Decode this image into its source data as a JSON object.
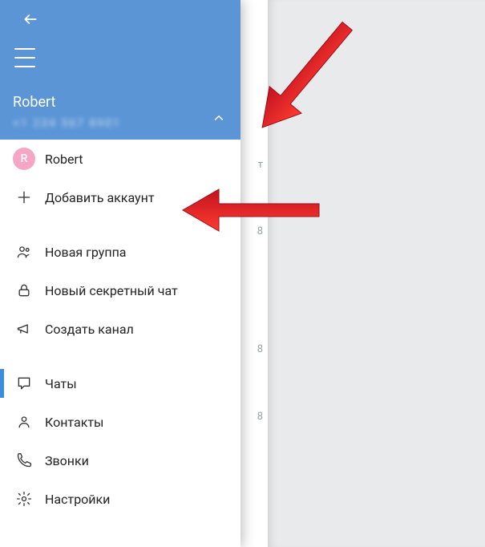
{
  "header": {
    "account_name": "Robert",
    "account_phone": "+1 234 567 8901"
  },
  "accounts": {
    "current_initial": "R",
    "current_label": "Robert",
    "add_label": "Добавить аккаунт"
  },
  "menu": {
    "new_group": "Новая группа",
    "secret_chat": "Новый секретный чат",
    "create_channel": "Создать канал",
    "chats": "Чаты",
    "contacts": "Контакты",
    "calls": "Звонки",
    "settings": "Настройки"
  },
  "peek": {
    "t1": "т",
    "t2": "8",
    "t3": "8",
    "t4": "8"
  }
}
